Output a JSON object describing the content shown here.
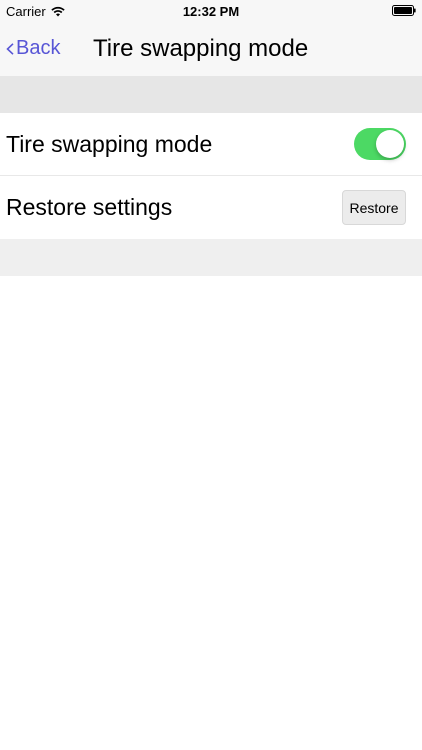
{
  "status_bar": {
    "carrier": "Carrier",
    "time": "12:32 PM",
    "icons": [
      "wifi-icon",
      "battery-icon"
    ]
  },
  "nav_bar": {
    "back_label": "Back",
    "title": "Tire swapping mode",
    "accent_color": "#5856d6"
  },
  "settings": {
    "tire_swapping": {
      "label": "Tire swapping mode",
      "enabled": true,
      "toggle_color": "#4cd964"
    },
    "restore": {
      "label": "Restore settings",
      "button_label": "Restore"
    }
  }
}
